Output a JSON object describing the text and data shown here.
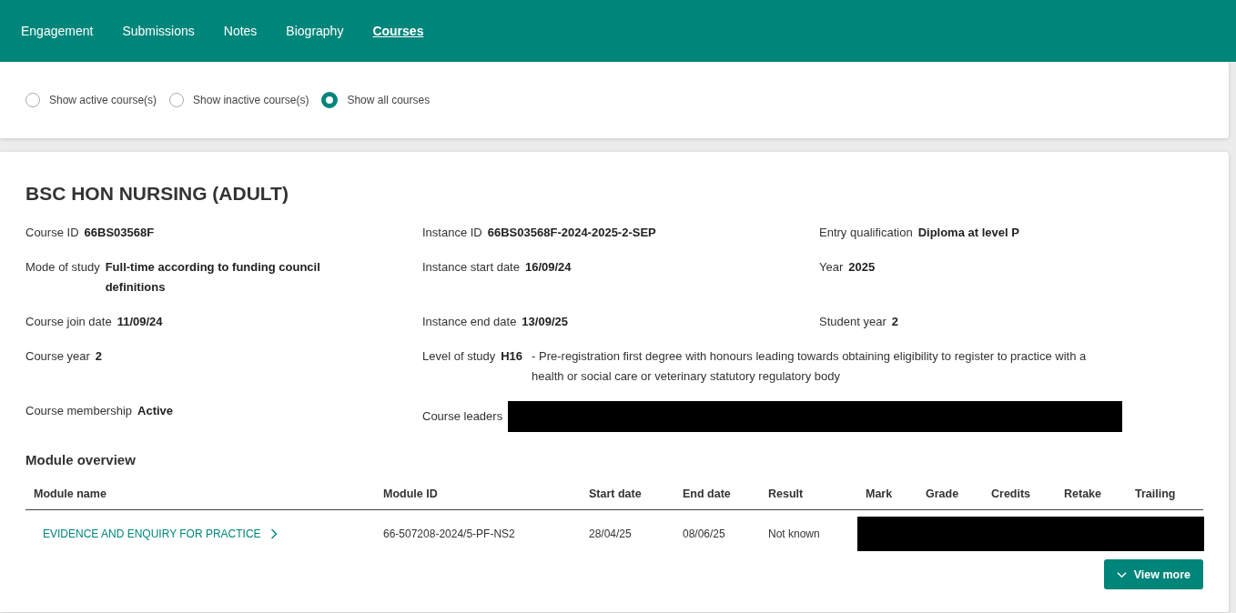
{
  "nav": {
    "tabs": [
      {
        "label": "Engagement",
        "selected": false
      },
      {
        "label": "Submissions",
        "selected": false
      },
      {
        "label": "Notes",
        "selected": false
      },
      {
        "label": "Biography",
        "selected": false
      },
      {
        "label": "Courses",
        "selected": true
      }
    ]
  },
  "filters": [
    {
      "label": "Show active course(s)",
      "selected": false
    },
    {
      "label": "Show inactive course(s)",
      "selected": false
    },
    {
      "label": "Show all courses",
      "selected": true
    }
  ],
  "course": {
    "title": "BSC HON NURSING (ADULT)",
    "fields": [
      {
        "kind": "text",
        "label": "Course ID",
        "value": "66BS03568F"
      },
      {
        "kind": "text",
        "label": "Instance ID",
        "value": "66BS03568F-2024-2025-2-SEP"
      },
      {
        "kind": "text",
        "label": "Entry qualification",
        "value": "Diploma at level P"
      },
      {
        "kind": "text",
        "label": "Mode of study",
        "value": "Full-time according to funding council definitions"
      },
      {
        "kind": "text",
        "label": "Instance start date",
        "value": "16/09/24"
      },
      {
        "kind": "text",
        "label": "Year",
        "value": "2025"
      },
      {
        "kind": "text",
        "label": "Course join date",
        "value": "11/09/24"
      },
      {
        "kind": "text",
        "label": "Instance end date",
        "value": "13/09/25"
      },
      {
        "kind": "text",
        "label": "Student year",
        "value": "2"
      },
      {
        "kind": "text",
        "label": "Course year",
        "value": "2"
      },
      {
        "kind": "level",
        "label": "Level of study",
        "code": "H16",
        "description": "- Pre-registration first degree with honours leading towards obtaining eligibility to register to practice with a health or social care or veterinary statutory regulatory body"
      },
      {
        "kind": "text",
        "label": "Course membership",
        "value": "Active"
      },
      {
        "kind": "redacted",
        "label": "Course leaders"
      }
    ]
  },
  "modules": {
    "heading": "Module overview",
    "columns": [
      "Module name",
      "Module ID",
      "Start date",
      "End date",
      "Result",
      "Mark",
      "Grade",
      "Credits",
      "Retake",
      "Trailing"
    ],
    "rows": [
      {
        "name": "EVIDENCE AND ENQUIRY FOR PRACTICE",
        "id": "66-507208-2024/5-PF-NS2",
        "start": "28/04/25",
        "end": "08/06/25",
        "result": "Not known",
        "marks_redacted": true
      }
    ],
    "button": "View more"
  }
}
